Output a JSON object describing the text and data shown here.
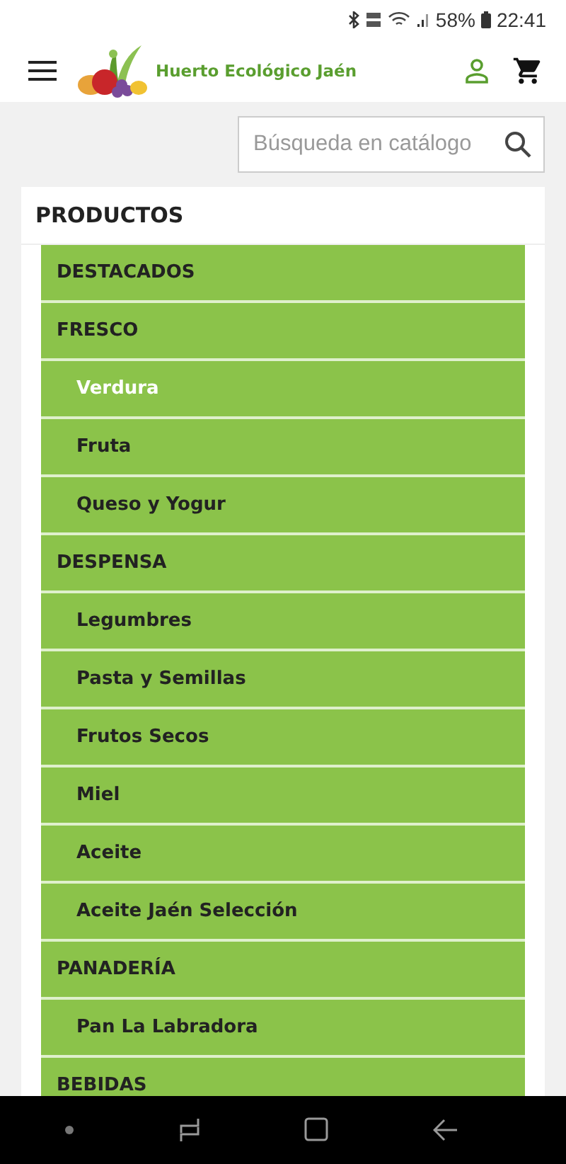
{
  "status_bar": {
    "battery": "58%",
    "time": "22:41"
  },
  "header": {
    "logo_text": "Huerto Ecológico Jaén"
  },
  "search": {
    "placeholder": "Búsqueda en catálogo"
  },
  "categories": {
    "title": "PRODUCTOS",
    "items": [
      {
        "label": "DESTACADOS",
        "selected": false
      },
      {
        "label": "FRESCO",
        "selected": false,
        "children": [
          {
            "label": "Verdura",
            "selected": true
          },
          {
            "label": "Fruta",
            "selected": false
          },
          {
            "label": "Queso y Yogur",
            "selected": false
          }
        ]
      },
      {
        "label": "DESPENSA",
        "selected": false,
        "children": [
          {
            "label": "Legumbres",
            "selected": false
          },
          {
            "label": "Pasta y Semillas",
            "selected": false
          },
          {
            "label": "Frutos Secos",
            "selected": false
          },
          {
            "label": "Miel",
            "selected": false
          },
          {
            "label": "Aceite",
            "selected": false
          },
          {
            "label": "Aceite Jaén Selección",
            "selected": false
          }
        ]
      },
      {
        "label": "PANADERÍA",
        "selected": false,
        "children": [
          {
            "label": "Pan La Labradora",
            "selected": false
          }
        ]
      },
      {
        "label": "BEBIDAS",
        "selected": false
      }
    ]
  }
}
